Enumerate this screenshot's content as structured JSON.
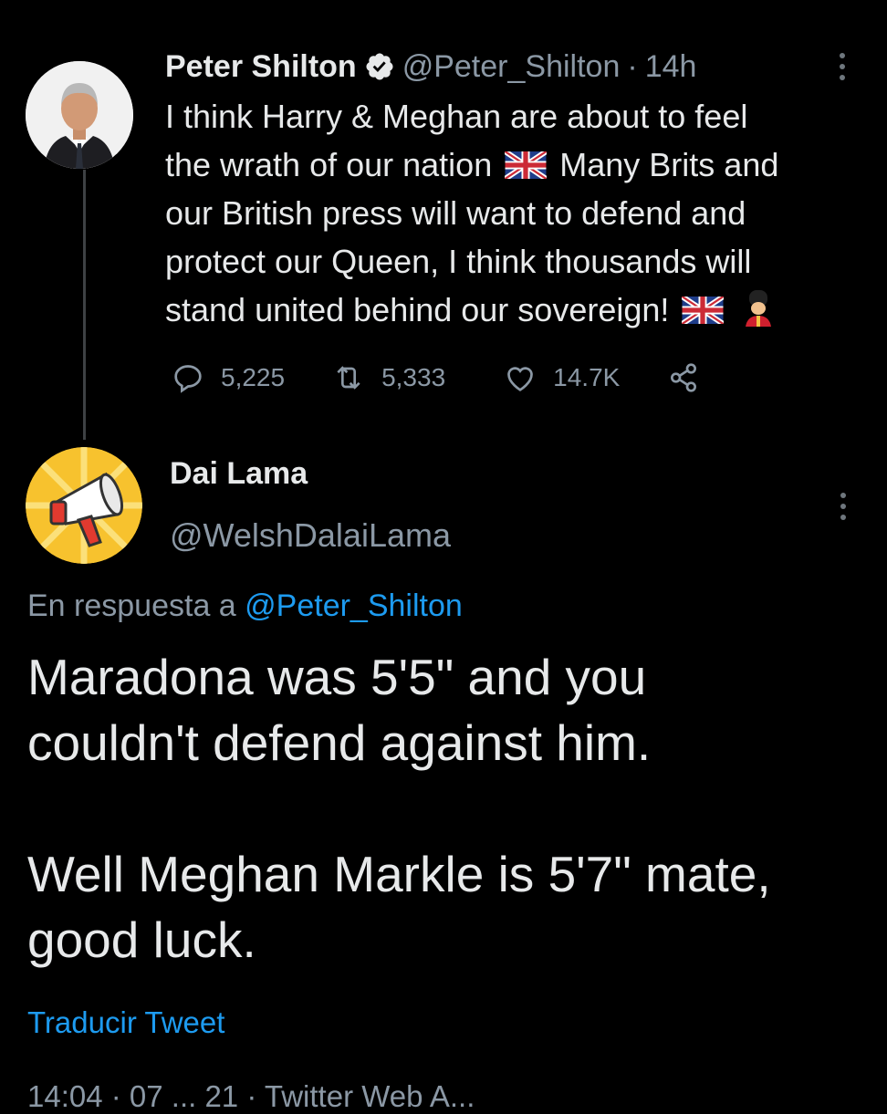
{
  "tweet": {
    "author_name": "Peter Shilton",
    "handle": "@Peter_Shilton",
    "separator": "·",
    "time": "14h",
    "lines": [
      "I think Harry & Meghan are about to feel",
      "the wrath of our nation",
      "Many Brits and",
      "our British press will want to defend and",
      "protect our Queen,  I think thousands will",
      "stand united behind our sovereign!"
    ],
    "replies": "5,225",
    "retweets": "5,333",
    "likes": "14.7K"
  },
  "reply": {
    "author_name": "Dai Lama",
    "handle": "@WelshDalaiLama",
    "reply_prefix": "En respuesta a",
    "reply_handle": "@Peter_Shilton",
    "text_lines": [
      "Maradona was 5'5\" and you",
      "couldn't defend against him.",
      "Well Meghan Markle is 5'7\" mate,",
      "good luck."
    ],
    "translate_label": "Traducir Tweet",
    "meta": "14:04 · 07 ... 21 · Twitter Web A..."
  },
  "colors": {
    "background": "#000000",
    "text": "#e7e9ea",
    "muted": "#8b98a5",
    "link": "#1d9bf0"
  },
  "icons": [
    "verified-badge-icon",
    "more-options-icon",
    "reply-icon",
    "retweet-icon",
    "like-icon",
    "share-icon",
    "uk-flag-emoji",
    "guardsman-emoji",
    "megaphone-avatar"
  ]
}
